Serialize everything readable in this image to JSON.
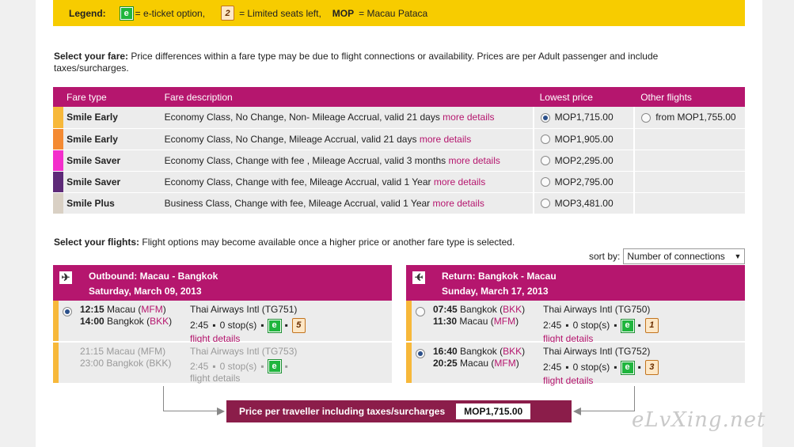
{
  "legend": {
    "title": "Legend:",
    "eticket_badge": "e",
    "eticket_text": "= e-ticket option,",
    "seats_badge": "2",
    "seats_text": "= Limited seats left,",
    "mop_abbr": "MOP",
    "mop_text": "= Macau Pataca"
  },
  "fare_section": {
    "heading": "Select your fare:",
    "note": "Price differences within a fare type may be due to flight connections or availability. Prices are per Adult passenger and include taxes/surcharges.",
    "columns": [
      "Fare type",
      "Fare description",
      "Lowest price",
      "Other flights"
    ],
    "more_label": "more details",
    "rows": [
      {
        "name": "Smile Early",
        "color": "#f7b83a",
        "desc": "Economy Class, No Change, Non- Mileage Accrual, valid 21 days",
        "price": "MOP1,715.00",
        "selected": true,
        "other": "from MOP1,755.00"
      },
      {
        "name": "Smile Early",
        "color": "#f48a32",
        "desc": "Economy Class, No Change, Mileage Accrual, valid 21 days",
        "price": "MOP1,905.00",
        "selected": false,
        "other": ""
      },
      {
        "name": "Smile Saver",
        "color": "#f32ecb",
        "desc": "Economy Class, Change with fee , Mileage Accrual, valid 3 months",
        "price": "MOP2,295.00",
        "selected": false,
        "other": ""
      },
      {
        "name": "Smile Saver",
        "color": "#5e2a78",
        "desc": "Economy Class, Change with fee, Mileage Accrual, valid 1 Year",
        "price": "MOP2,795.00",
        "selected": false,
        "other": ""
      },
      {
        "name": "Smile Plus",
        "color": "#d9d0c4",
        "desc": "Business Class, Change with fee, Mileage Accrual, valid 1 Year",
        "price": "MOP3,481.00",
        "selected": false,
        "other": ""
      }
    ]
  },
  "flights_section": {
    "heading": "Select your flights:",
    "note": "Flight options may become available once a higher price or another fare type is selected.",
    "sort_label": "sort by:",
    "sort_value": "Number of connections"
  },
  "outbound": {
    "title": "Outbound: Macau - Bangkok",
    "date": "Saturday, March 09, 2013",
    "flights": [
      {
        "dep_time": "12:15",
        "dep_city": "Macau",
        "dep_code": "MFM",
        "arr_time": "14:00",
        "arr_city": "Bangkok",
        "arr_code": "BKK",
        "airline": "Thai Airways Intl (TG751)",
        "duration": "2:45",
        "stops": "0 stop(s)",
        "seats": "5",
        "details": "flight details",
        "selected": true,
        "dim": false
      },
      {
        "dep_time": "21:15",
        "dep_city": "Macau",
        "dep_code": "MFM",
        "arr_time": "23:00",
        "arr_city": "Bangkok",
        "arr_code": "BKK",
        "airline": "Thai Airways Intl (TG753)",
        "duration": "2:45",
        "stops": "0 stop(s)",
        "seats": "",
        "details": "flight details",
        "selected": false,
        "dim": true
      }
    ]
  },
  "return": {
    "title": "Return: Bangkok - Macau",
    "date": "Sunday, March 17, 2013",
    "flights": [
      {
        "dep_time": "07:45",
        "dep_city": "Bangkok",
        "dep_code": "BKK",
        "arr_time": "11:30",
        "arr_city": "Macau",
        "arr_code": "MFM",
        "airline": "Thai Airways Intl (TG750)",
        "duration": "2:45",
        "stops": "0 stop(s)",
        "seats": "1",
        "details": "flight details",
        "selected": false,
        "dim": false
      },
      {
        "dep_time": "16:40",
        "dep_city": "Bangkok",
        "dep_code": "BKK",
        "arr_time": "20:25",
        "arr_city": "Macau",
        "arr_code": "MFM",
        "airline": "Thai Airways Intl (TG752)",
        "duration": "2:45",
        "stops": "0 stop(s)",
        "seats": "3",
        "details": "flight details",
        "selected": true,
        "dim": false
      }
    ]
  },
  "total": {
    "label": "Price per traveller including taxes/surcharges",
    "amount": "MOP1,715.00"
  },
  "watermark": "eLvXing.net"
}
